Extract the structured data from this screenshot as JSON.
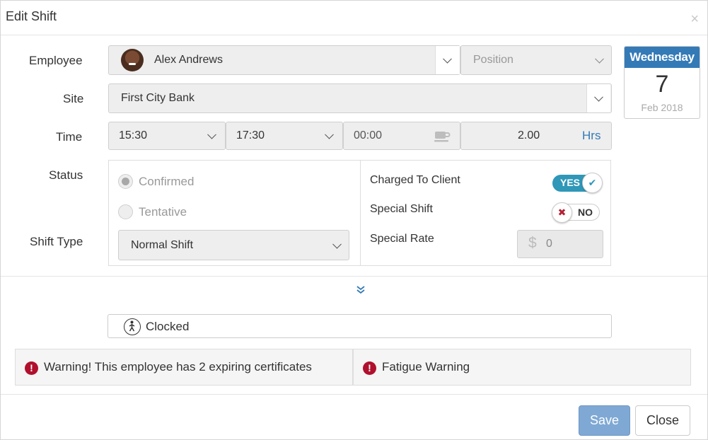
{
  "dialog": {
    "title": "Edit Shift",
    "close_glyph": "×"
  },
  "labels": {
    "employee": "Employee",
    "site": "Site",
    "time": "Time",
    "status": "Status",
    "shift_type": "Shift Type"
  },
  "employee": {
    "name": "Alex Andrews",
    "position_placeholder": "Position"
  },
  "site": {
    "value": "First City Bank"
  },
  "time": {
    "start": "15:30",
    "end": "17:30",
    "break": "00:00",
    "hours": "2.00",
    "hours_unit": "Hrs"
  },
  "date": {
    "weekday": "Wednesday",
    "day": "7",
    "month_year": "Feb 2018"
  },
  "status": {
    "options": [
      "Confirmed",
      "Tentative"
    ],
    "selected": "Confirmed"
  },
  "shift_type": {
    "value": "Normal Shift"
  },
  "flags": {
    "charged_to_client": {
      "label": "Charged To Client",
      "state": "YES",
      "check_glyph": "✔"
    },
    "special_shift": {
      "label": "Special Shift",
      "state": "NO",
      "x_glyph": "✖"
    },
    "special_rate": {
      "label": "Special Rate",
      "currency": "$",
      "value": "0"
    }
  },
  "expand_glyph": "»",
  "clocked": {
    "label": "Clocked"
  },
  "warnings": [
    {
      "text": "Warning! This employee has 2 expiring certificates",
      "glyph": "!"
    },
    {
      "text": "Fatigue Warning",
      "glyph": "!"
    }
  ],
  "buttons": {
    "save": "Save",
    "close": "Close"
  },
  "colors": {
    "accent": "#337ab7",
    "toggle_on": "#2f97b8",
    "warning": "#b0102d",
    "save_button": "#7fa9d4"
  }
}
